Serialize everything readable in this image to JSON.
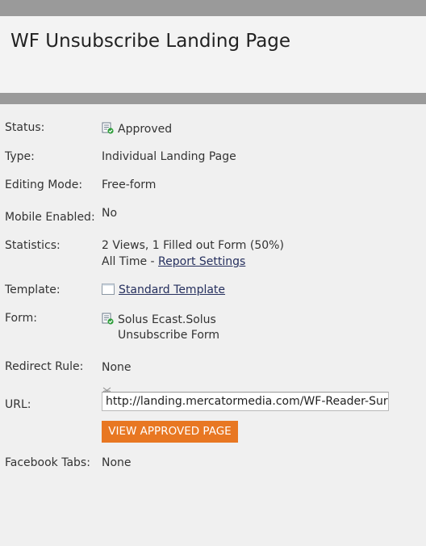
{
  "page": {
    "title": "WF Unsubscribe Landing Page"
  },
  "details": {
    "status": {
      "label": "Status:",
      "value": "Approved"
    },
    "type": {
      "label": "Type:",
      "value": "Individual Landing Page"
    },
    "editing_mode": {
      "label": "Editing Mode:",
      "value": "Free-form"
    },
    "mobile": {
      "label": "Mobile Enabled:",
      "value": "No"
    },
    "statistics": {
      "label": "Statistics:",
      "line1": "2 Views, 1 Filled out Form (50%)",
      "prefix": "All Time - ",
      "link": "Report Settings"
    },
    "template": {
      "label": "Template:",
      "value": "Standard Template"
    },
    "form": {
      "label": "Form:",
      "line1": "Solus Ecast.Solus",
      "line2": "Unsubscribe Form"
    },
    "redirect": {
      "label": "Redirect Rule:",
      "value": "None"
    },
    "url": {
      "label": "URL:",
      "value": "http://landing.mercatormedia.com/WF-Reader-Survey"
    },
    "view_button": "VIEW APPROVED PAGE",
    "facebook": {
      "label": "Facebook Tabs:",
      "value": "None"
    }
  },
  "icons": {
    "status": "approved-doc-icon",
    "template": "template-page-icon",
    "form": "form-approved-icon",
    "url_copy": "scissors-icon"
  },
  "colors": {
    "accent": "#e87722",
    "link": "#26305e",
    "bar": "#9a9a9a",
    "background": "#f0f0f0"
  }
}
